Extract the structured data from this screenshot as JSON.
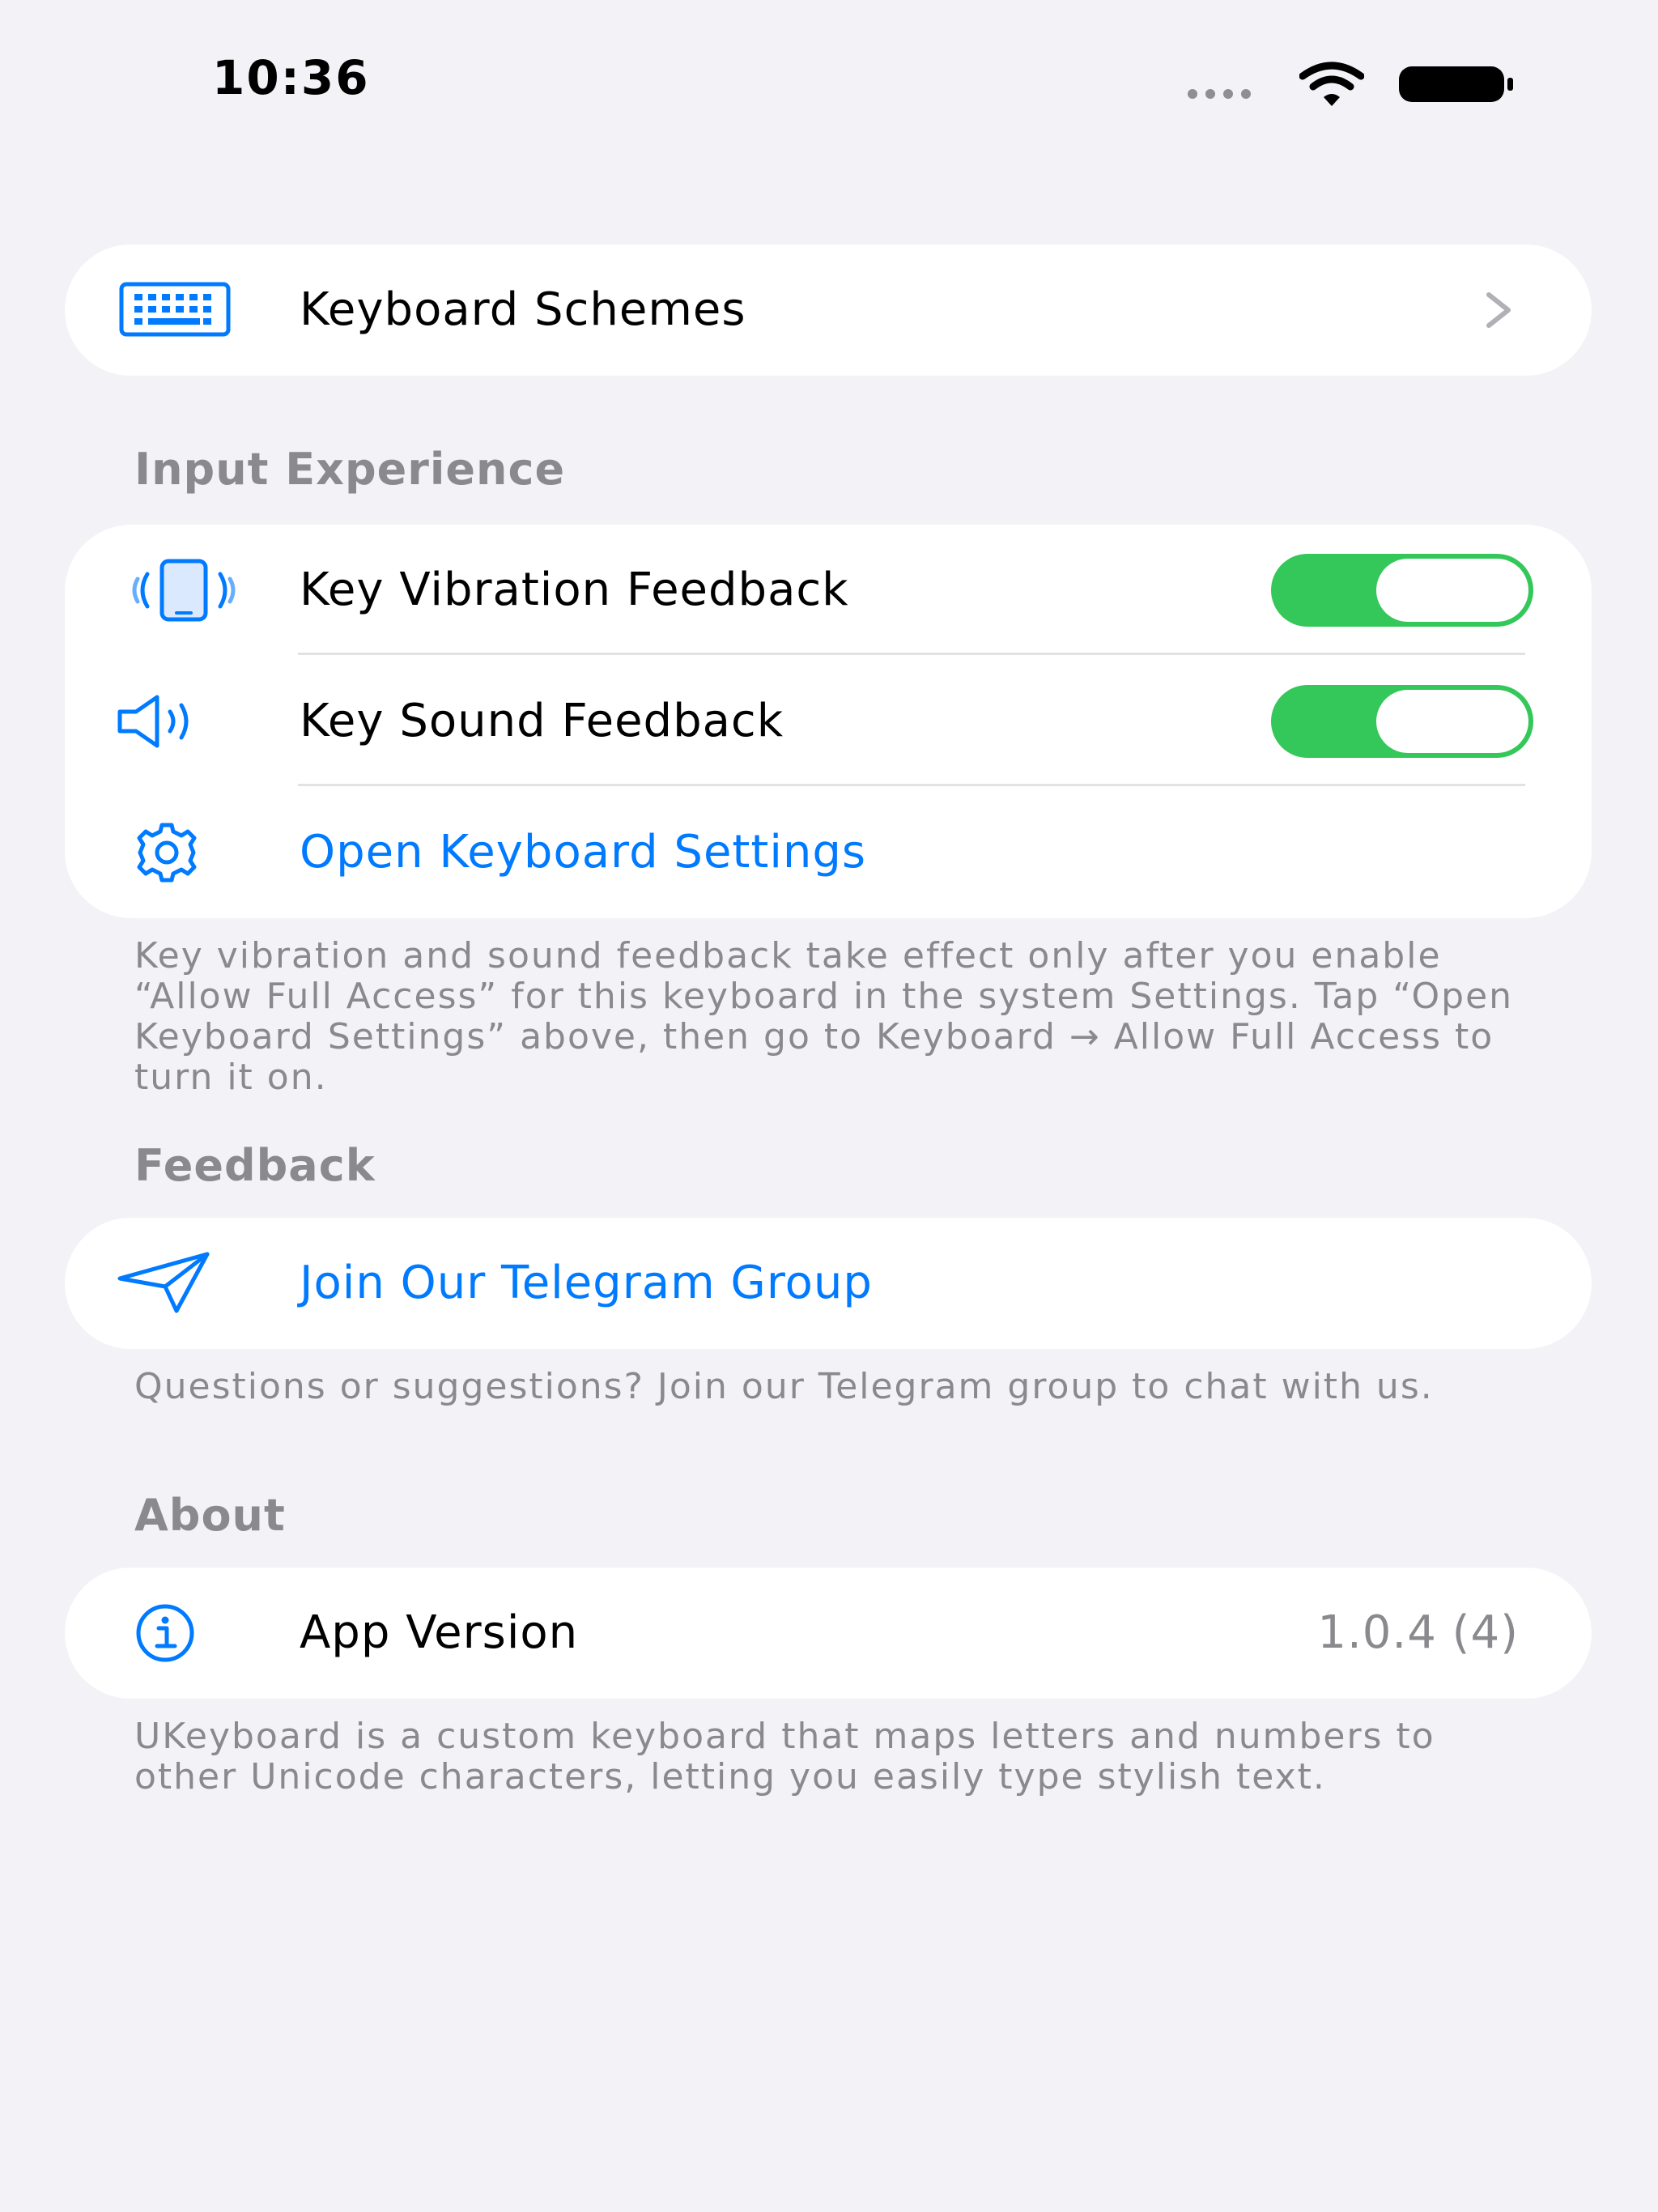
{
  "status_bar": {
    "time": "10:36"
  },
  "keyboard_schemes": {
    "icon": "keyboard-icon",
    "label": "Keyboard Schemes"
  },
  "input_experience": {
    "header": "Input Experience",
    "vibration": {
      "icon": "phone-vibration-icon",
      "label": "Key Vibration Feedback",
      "enabled": true
    },
    "sound": {
      "icon": "speaker-wave-icon",
      "label": "Key Sound Feedback",
      "enabled": true
    },
    "open_settings": {
      "icon": "gear-icon",
      "label": "Open Keyboard Settings"
    },
    "footer": "Key vibration and sound feedback take effect only after you enable “Allow Full Access” for this keyboard in the system Settings. Tap “Open Keyboard Settings” above, then go to Keyboard → Allow Full Access to turn it on."
  },
  "feedback": {
    "header": "Feedback",
    "telegram": {
      "icon": "paper-plane-icon",
      "label": "Join Our Telegram Group"
    },
    "footer": "Questions or suggestions? Join our Telegram group to chat with us."
  },
  "about": {
    "header": "About",
    "version": {
      "icon": "info-icon",
      "label": "App Version",
      "value": "1.0.4 (4)"
    },
    "footer": "UKeyboard is a custom keyboard that maps letters and numbers to other Unicode characters, letting you easily type stylish text."
  },
  "colors": {
    "accent": "#007aff",
    "toggle_on": "#34c759",
    "background": "#f2f2f7",
    "secondary_text": "#8a8a8e"
  }
}
